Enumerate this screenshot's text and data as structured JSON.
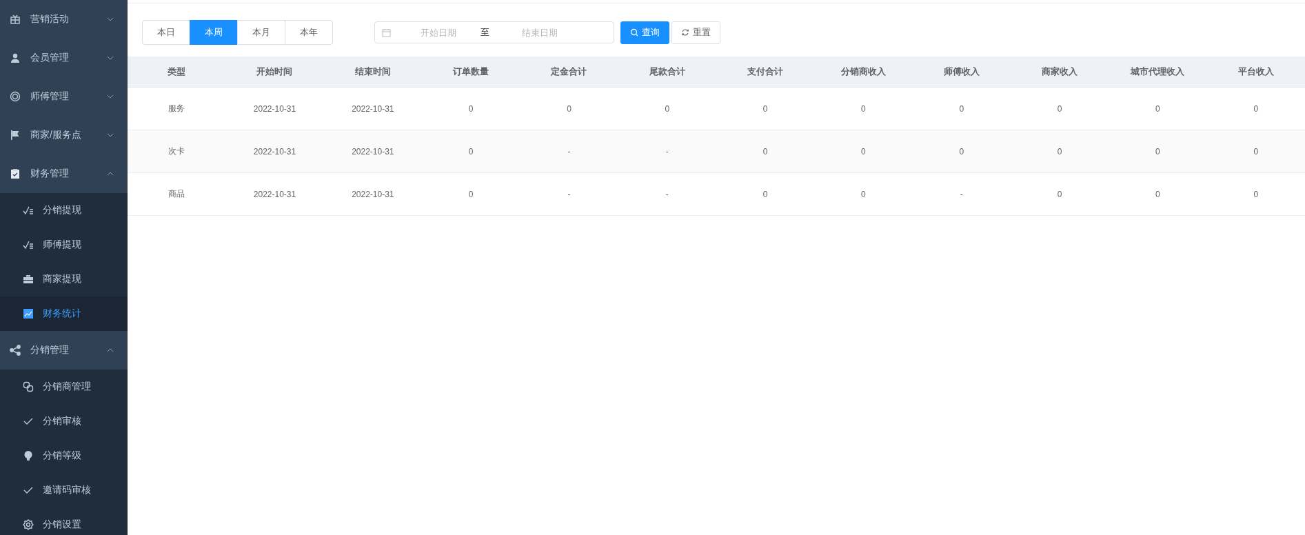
{
  "sidebar": {
    "items": [
      {
        "label": "营销活动",
        "expanded": false
      },
      {
        "label": "会员管理",
        "expanded": false
      },
      {
        "label": "师傅管理",
        "expanded": false
      },
      {
        "label": "商家/服务点",
        "expanded": false
      },
      {
        "label": "财务管理",
        "expanded": true,
        "children": [
          {
            "label": "分销提现",
            "selected": false
          },
          {
            "label": "师傅提现",
            "selected": false
          },
          {
            "label": "商家提现",
            "selected": false
          },
          {
            "label": "财务统计",
            "selected": true
          }
        ]
      },
      {
        "label": "分销管理",
        "expanded": true,
        "children": [
          {
            "label": "分销商管理",
            "selected": false
          },
          {
            "label": "分销审核",
            "selected": false
          },
          {
            "label": "分销等级",
            "selected": false
          },
          {
            "label": "邀请码审核",
            "selected": false
          },
          {
            "label": "分销设置",
            "selected": false
          }
        ]
      }
    ]
  },
  "period_tabs": [
    {
      "label": "本日",
      "selected": false
    },
    {
      "label": "本周",
      "selected": true
    },
    {
      "label": "本月",
      "selected": false
    },
    {
      "label": "本年",
      "selected": false
    }
  ],
  "date_range": {
    "start_placeholder": "开始日期",
    "separator": "至",
    "end_placeholder": "结束日期"
  },
  "buttons": [
    {
      "kind": "primary",
      "label": "查询"
    },
    {
      "kind": "default",
      "label": "重置"
    }
  ],
  "table": {
    "columns": [
      "类型",
      "开始时间",
      "结束时间",
      "订单数量",
      "定金合计",
      "尾款合计",
      "支付合计",
      "分销商收入",
      "师傅收入",
      "商家收入",
      "城市代理收入",
      "平台收入"
    ],
    "rows": [
      [
        "服务",
        "2022-10-31",
        "2022-10-31",
        "0",
        "0",
        "0",
        "0",
        "0",
        "0",
        "0",
        "0",
        "0"
      ],
      [
        "次卡",
        "2022-10-31",
        "2022-10-31",
        "0",
        "-",
        "-",
        "0",
        "0",
        "0",
        "0",
        "0",
        "0"
      ],
      [
        "商品",
        "2022-10-31",
        "2022-10-31",
        "0",
        "-",
        "-",
        "0",
        "0",
        "-",
        "0",
        "0",
        "0"
      ]
    ]
  }
}
